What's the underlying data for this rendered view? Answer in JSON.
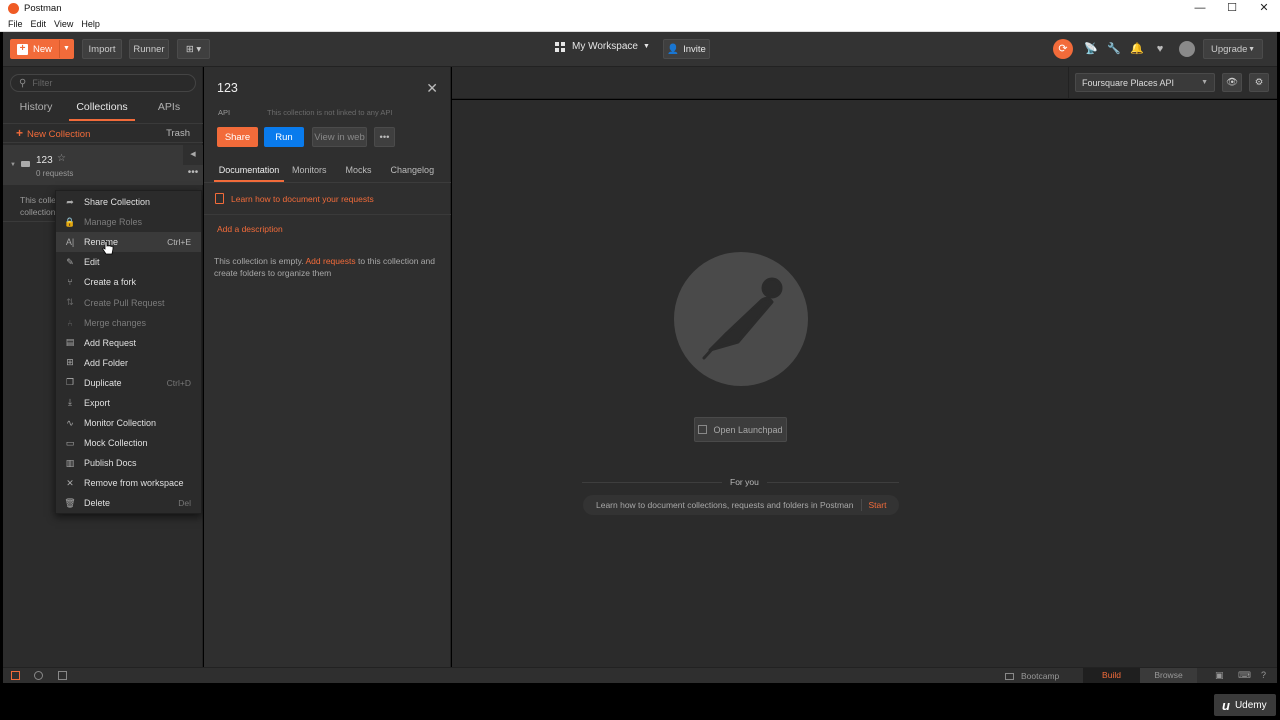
{
  "window": {
    "title": "Postman",
    "menu": [
      "File",
      "Edit",
      "View",
      "Help"
    ],
    "controls": {
      "minimize": "—",
      "maximize": "☐",
      "close": "✕"
    }
  },
  "header": {
    "new_label": "New",
    "import_label": "Import",
    "runner_label": "Runner",
    "workspace_label": "My Workspace",
    "invite_label": "Invite",
    "upgrade_label": "Upgrade",
    "icons": [
      "sync-icon",
      "satellite-icon",
      "wrench-icon",
      "bell-icon",
      "heart-icon",
      "avatar"
    ]
  },
  "sidebar": {
    "filter_placeholder": "Filter",
    "tabs": {
      "history": "History",
      "collections": "Collections",
      "apis": "APIs"
    },
    "new_collection_label": "New Collection",
    "trash_label": "Trash",
    "collection": {
      "name": "123",
      "request_count": "0 requests"
    },
    "desc_snippet_1": "This colle",
    "desc_snippet_2": "collection"
  },
  "context_menu": {
    "items": [
      {
        "label": "Share Collection",
        "icon": "share-icon",
        "shortcut": "",
        "disabled": false
      },
      {
        "label": "Manage Roles",
        "icon": "lock-icon",
        "shortcut": "",
        "disabled": true
      },
      {
        "label": "Rename",
        "icon": "rename-icon",
        "shortcut": "Ctrl+E",
        "disabled": false
      },
      {
        "label": "Edit",
        "icon": "pencil-icon",
        "shortcut": "",
        "disabled": false
      },
      {
        "label": "Create a fork",
        "icon": "fork-icon",
        "shortcut": "",
        "disabled": false
      },
      {
        "label": "Create Pull Request",
        "icon": "pull-request-icon",
        "shortcut": "",
        "disabled": true
      },
      {
        "label": "Merge changes",
        "icon": "merge-icon",
        "shortcut": "",
        "disabled": true
      },
      {
        "label": "Add Request",
        "icon": "request-icon",
        "shortcut": "",
        "disabled": false
      },
      {
        "label": "Add Folder",
        "icon": "folder-add-icon",
        "shortcut": "",
        "disabled": false
      },
      {
        "label": "Duplicate",
        "icon": "duplicate-icon",
        "shortcut": "Ctrl+D",
        "disabled": false
      },
      {
        "label": "Export",
        "icon": "export-icon",
        "shortcut": "",
        "disabled": false
      },
      {
        "label": "Monitor Collection",
        "icon": "monitor-icon",
        "shortcut": "",
        "disabled": false
      },
      {
        "label": "Mock Collection",
        "icon": "mock-icon",
        "shortcut": "",
        "disabled": false
      },
      {
        "label": "Publish Docs",
        "icon": "docs-icon",
        "shortcut": "",
        "disabled": false
      },
      {
        "label": "Remove from workspace",
        "icon": "remove-icon",
        "shortcut": "",
        "disabled": false
      },
      {
        "label": "Delete",
        "icon": "trash-icon",
        "shortcut": "Del",
        "disabled": false
      }
    ]
  },
  "panel": {
    "name": "123",
    "kind": "API",
    "not_linked": "This collection is not linked to any API",
    "share_label": "Share",
    "run_label": "Run",
    "view_web_label": "View in web",
    "more_label": "•••",
    "tabs": {
      "documentation": "Documentation",
      "monitors": "Monitors",
      "mocks": "Mocks",
      "changelog": "Changelog"
    },
    "learn_link": "Learn how to document your requests",
    "add_description": "Add a description",
    "empty_prefix": "This collection is empty. ",
    "empty_link": "Add requests",
    "empty_suffix": " to this collection and create folders to organize them"
  },
  "main": {
    "environment": "Foursquare Places API",
    "open_launchpad": "Open Launchpad",
    "for_you": "For you",
    "learn_card_text": "Learn how to document collections, requests and folders in Postman",
    "learn_card_start": "Start"
  },
  "statusbar": {
    "bootcamp": "Bootcamp",
    "build": "Build",
    "browse": "Browse"
  },
  "watermark": {
    "brand": "Udemy"
  },
  "colors": {
    "accent": "#f26b3a",
    "run_blue": "#097bed",
    "background": "#2b2b2b"
  }
}
